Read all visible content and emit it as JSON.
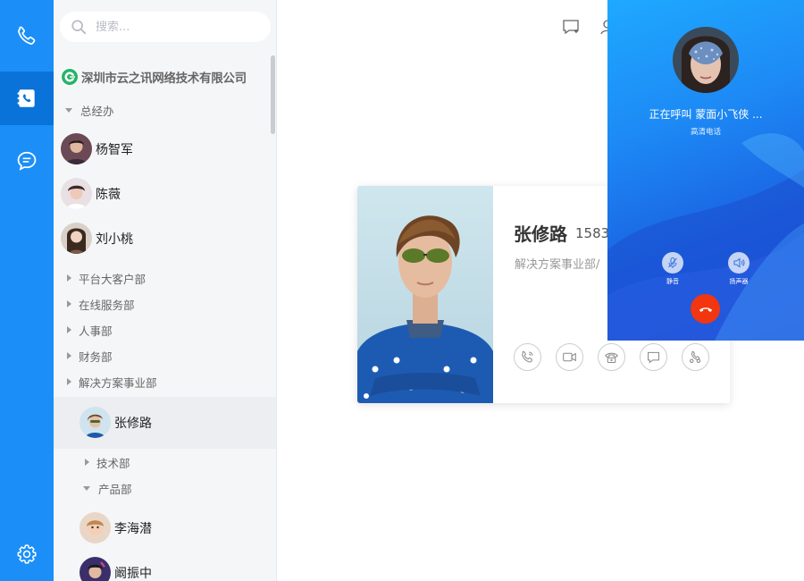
{
  "nav": {
    "items": [
      "phone-icon",
      "contacts-icon",
      "chat-icon"
    ],
    "settings_icon": "gear-icon",
    "accent": "#1b8ff7"
  },
  "search": {
    "placeholder": "搜索..."
  },
  "company": {
    "name": "深圳市云之讯网络技术有限公司"
  },
  "tree": {
    "dept_general": "总经办",
    "people_general": [
      "杨智军",
      "陈薇",
      "刘小桃"
    ],
    "depts": [
      "平台大客户部",
      "在线服务部",
      "人事部",
      "财务部",
      "解决方案事业部"
    ],
    "selected_person": "张修路",
    "sub_depts": [
      "技术部",
      "产品部"
    ],
    "people_product": [
      "李海潜",
      "阚振中"
    ]
  },
  "card": {
    "name": "张修路",
    "phone": "1583",
    "dept": "解决方案事业部/",
    "actions": [
      "voice-call-icon",
      "video-call-icon",
      "landline-icon",
      "message-icon",
      "conference-icon"
    ]
  },
  "call": {
    "status": "正在呼叫  蒙面小飞侠 ...",
    "sub": "高清电话",
    "mute_label": "静音",
    "speaker_label": "扬声器",
    "hangup_color": "#f2360f"
  }
}
